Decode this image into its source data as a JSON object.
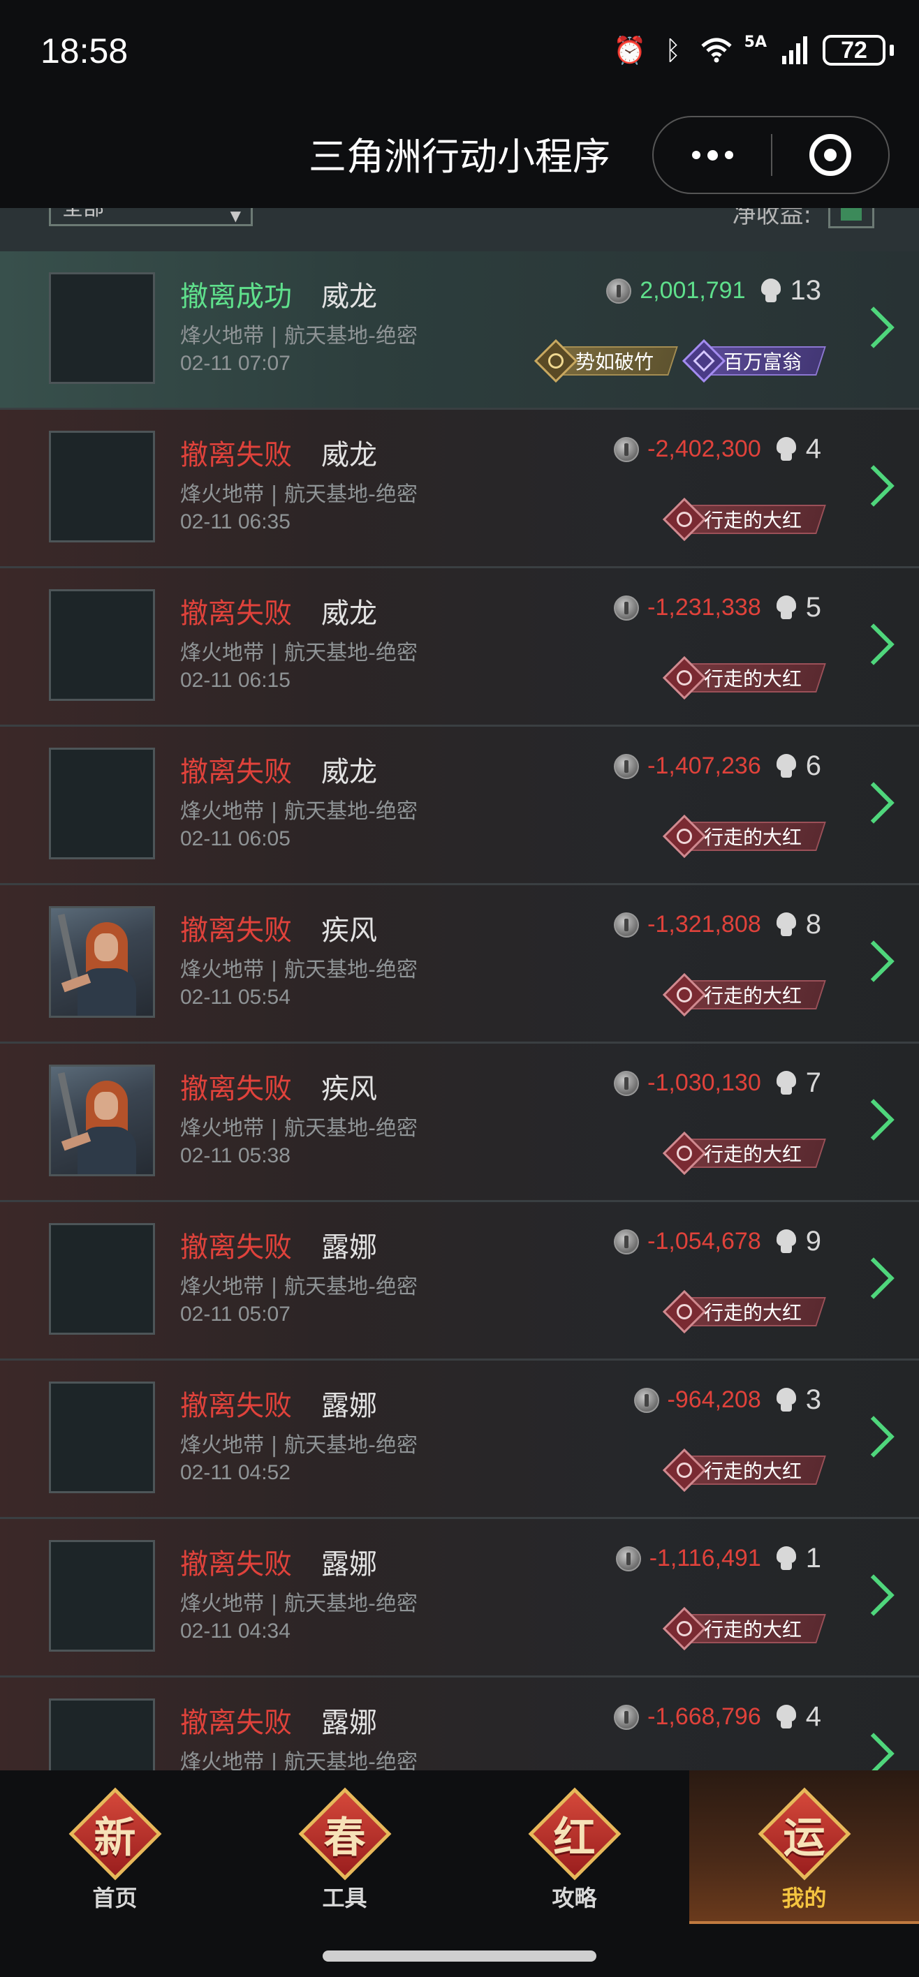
{
  "status_bar": {
    "time": "18:58",
    "network": "5A",
    "battery": "72",
    "icons": [
      "alarm-icon",
      "bluetooth-icon",
      "wifi-icon",
      "signal-icon",
      "battery-icon"
    ]
  },
  "title_bar": {
    "title": "三角洲行动小程序",
    "icons": [
      "more-dots-icon",
      "close-target-icon"
    ]
  },
  "filter": {
    "select_value": "全部",
    "right_label": "净收益:"
  },
  "colors": {
    "success": "#5fe08c",
    "fail": "#e0423b",
    "chevron": "#4fd67c",
    "active_tab": "#f4c440"
  },
  "records": [
    {
      "status": "撤离成功",
      "result": "success",
      "operator": "威龙",
      "map": "烽火地带 | 航天基地-绝密",
      "time": "02-11 07:07",
      "value": "2,001,791",
      "kills": "13",
      "avatar": "empty",
      "badges": [
        {
          "label": "势如破竹",
          "style": "gold"
        },
        {
          "label": "百万富翁",
          "style": "purple"
        }
      ]
    },
    {
      "status": "撤离失败",
      "result": "fail",
      "operator": "威龙",
      "map": "烽火地带 | 航天基地-绝密",
      "time": "02-11 06:35",
      "value": "-2,402,300",
      "kills": "4",
      "avatar": "empty",
      "badges": [
        {
          "label": "行走的大红",
          "style": "red"
        }
      ]
    },
    {
      "status": "撤离失败",
      "result": "fail",
      "operator": "威龙",
      "map": "烽火地带 | 航天基地-绝密",
      "time": "02-11 06:15",
      "value": "-1,231,338",
      "kills": "5",
      "avatar": "empty",
      "badges": [
        {
          "label": "行走的大红",
          "style": "red"
        }
      ]
    },
    {
      "status": "撤离失败",
      "result": "fail",
      "operator": "威龙",
      "map": "烽火地带 | 航天基地-绝密",
      "time": "02-11 06:05",
      "value": "-1,407,236",
      "kills": "6",
      "avatar": "empty",
      "badges": [
        {
          "label": "行走的大红",
          "style": "red"
        }
      ]
    },
    {
      "status": "撤离失败",
      "result": "fail",
      "operator": "疾风",
      "map": "烽火地带 | 航天基地-绝密",
      "time": "02-11 05:54",
      "value": "-1,321,808",
      "kills": "8",
      "avatar": "hero",
      "badges": [
        {
          "label": "行走的大红",
          "style": "red"
        }
      ]
    },
    {
      "status": "撤离失败",
      "result": "fail",
      "operator": "疾风",
      "map": "烽火地带 | 航天基地-绝密",
      "time": "02-11 05:38",
      "value": "-1,030,130",
      "kills": "7",
      "avatar": "hero",
      "badges": [
        {
          "label": "行走的大红",
          "style": "red"
        }
      ]
    },
    {
      "status": "撤离失败",
      "result": "fail",
      "operator": "露娜",
      "map": "烽火地带 | 航天基地-绝密",
      "time": "02-11 05:07",
      "value": "-1,054,678",
      "kills": "9",
      "avatar": "empty",
      "badges": [
        {
          "label": "行走的大红",
          "style": "red"
        }
      ]
    },
    {
      "status": "撤离失败",
      "result": "fail",
      "operator": "露娜",
      "map": "烽火地带 | 航天基地-绝密",
      "time": "02-11 04:52",
      "value": "-964,208",
      "kills": "3",
      "avatar": "empty",
      "badges": [
        {
          "label": "行走的大红",
          "style": "red"
        }
      ]
    },
    {
      "status": "撤离失败",
      "result": "fail",
      "operator": "露娜",
      "map": "烽火地带 | 航天基地-绝密",
      "time": "02-11 04:34",
      "value": "-1,116,491",
      "kills": "1",
      "avatar": "empty",
      "badges": [
        {
          "label": "行走的大红",
          "style": "red"
        }
      ]
    },
    {
      "status": "撤离失败",
      "result": "fail",
      "operator": "露娜",
      "map": "烽火地带 | 航天基地-绝密",
      "time": "",
      "value": "-1,668,796",
      "kills": "4",
      "avatar": "empty",
      "badges": []
    }
  ],
  "bottom_nav": [
    {
      "char": "新",
      "label": "首页",
      "active": false
    },
    {
      "char": "春",
      "label": "工具",
      "active": false
    },
    {
      "char": "红",
      "label": "攻略",
      "active": false
    },
    {
      "char": "运",
      "label": "我的",
      "active": true
    }
  ]
}
